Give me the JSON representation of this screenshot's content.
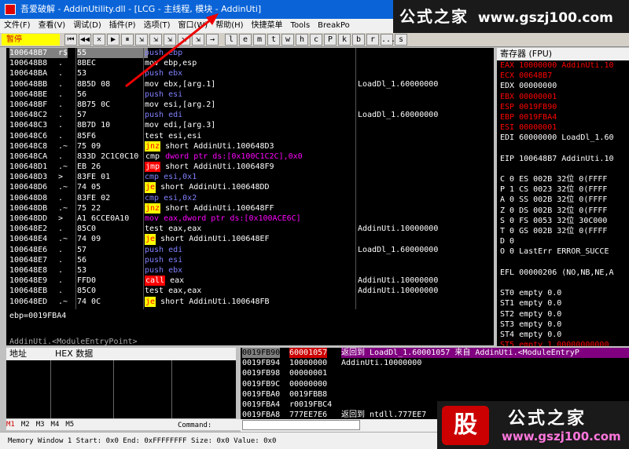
{
  "window": {
    "title": "吾爱破解 - AddinUtility.dll - [LCG - 主线程, 模块 - AddinUti]"
  },
  "menubar": [
    "文件(F)",
    "查看(V)",
    "调试(D)",
    "插件(P)",
    "选项(T)",
    "窗口(W)",
    "帮助(H)",
    "快捷菜单",
    "Tools",
    "BreakPo"
  ],
  "toolbar": {
    "status": "暂停",
    "buttons": [
      "⏮",
      "◀◀",
      "✕",
      "▶",
      "⏸",
      "⇲",
      "⇲",
      "⇲",
      "⇲",
      "⇲",
      "→"
    ],
    "letters": [
      "l",
      "e",
      "m",
      "t",
      "w",
      "h",
      "c",
      "P",
      "k",
      "b",
      "r",
      "...",
      "s"
    ]
  },
  "disasm": [
    {
      "addr": "100648B7",
      "mark": "r$",
      "hex": "55",
      "asm": "push ebp",
      "cmt": "",
      "color": "#8080ff",
      "sel": true
    },
    {
      "addr": "100648B8",
      "mark": ".",
      "hex": "8BEC",
      "asm": "mov ebp,esp",
      "cmt": "",
      "color": "#fff"
    },
    {
      "addr": "100648BA",
      "mark": ".",
      "hex": "53",
      "asm": "push ebx",
      "cmt": "",
      "color": "#8080ff"
    },
    {
      "addr": "100648BB",
      "mark": ".",
      "hex": "8B5D 08",
      "asm": "mov ebx,[arg.1]",
      "cmt": "LoadDl_1.60000000",
      "color": "#fff"
    },
    {
      "addr": "100648BE",
      "mark": ".",
      "hex": "56",
      "asm": "push esi",
      "cmt": "",
      "color": "#8080ff"
    },
    {
      "addr": "100648BF",
      "mark": ".",
      "hex": "8B75 0C",
      "asm": "mov esi,[arg.2]",
      "cmt": "",
      "color": "#fff"
    },
    {
      "addr": "100648C2",
      "mark": ".",
      "hex": "57",
      "asm": "push edi",
      "cmt": "LoadDl_1.60000000",
      "color": "#8080ff"
    },
    {
      "addr": "100648C3",
      "mark": ".",
      "hex": "8B7D 10",
      "asm": "mov edi,[arg.3]",
      "cmt": "",
      "color": "#fff"
    },
    {
      "addr": "100648C6",
      "mark": ".",
      "hex": "85F6",
      "asm": "test esi,esi",
      "cmt": "",
      "color": "#fff"
    },
    {
      "addr": "100648C8",
      "mark": ".~",
      "hex": "75 09",
      "asm": "short AddinUti.100648D3",
      "kw": "jnz",
      "kwbg": "#ff0",
      "cmt": "",
      "color": "#fff"
    },
    {
      "addr": "100648CA",
      "mark": ".",
      "hex": "833D 2C1C0C10",
      "asm": "dword ptr ds:[0x100C1C2C],0x0",
      "kw": "cmp",
      "cmt": "",
      "color": "#f0f"
    },
    {
      "addr": "100648D1",
      "mark": ".~",
      "hex": "EB 26",
      "asm": "short AddinUti.100648F9",
      "kw": "jmp",
      "kwbg": "#f00",
      "cmt": "",
      "color": "#fff"
    },
    {
      "addr": "100648D3",
      "mark": ">",
      "hex": "83FE 01",
      "asm": "cmp esi,0x1",
      "cmt": "",
      "color": "#8080ff"
    },
    {
      "addr": "100648D6",
      "mark": ".~",
      "hex": "74 05",
      "asm": "short AddinUti.100648DD",
      "kw": "je",
      "kwbg": "#ff0",
      "cmt": "",
      "color": "#fff"
    },
    {
      "addr": "100648D8",
      "mark": ".",
      "hex": "83FE 02",
      "asm": "cmp esi,0x2",
      "cmt": "",
      "color": "#8080ff"
    },
    {
      "addr": "100648DB",
      "mark": ".~",
      "hex": "75 22",
      "asm": "short AddinUti.100648FF",
      "kw": "jnz",
      "kwbg": "#ff0",
      "cmt": "",
      "color": "#fff"
    },
    {
      "addr": "100648DD",
      "mark": ">",
      "hex": "A1 6CCE0A10",
      "asm": "mov eax,dword ptr ds:[0x100ACE6C]",
      "cmt": "",
      "color": "#f0f"
    },
    {
      "addr": "100648E2",
      "mark": ".",
      "hex": "85C0",
      "asm": "test eax,eax",
      "cmt": "AddinUti.10000000",
      "color": "#fff"
    },
    {
      "addr": "100648E4",
      "mark": ".~",
      "hex": "74 09",
      "asm": "short AddinUti.100648EF",
      "kw": "je",
      "kwbg": "#ff0",
      "cmt": "",
      "color": "#fff"
    },
    {
      "addr": "100648E6",
      "mark": ".",
      "hex": "57",
      "asm": "push edi",
      "cmt": "LoadDl_1.60000000",
      "color": "#8080ff"
    },
    {
      "addr": "100648E7",
      "mark": ".",
      "hex": "56",
      "asm": "push esi",
      "cmt": "",
      "color": "#8080ff"
    },
    {
      "addr": "100648E8",
      "mark": ".",
      "hex": "53",
      "asm": "push ebx",
      "cmt": "",
      "color": "#8080ff"
    },
    {
      "addr": "100648E9",
      "mark": ".",
      "hex": "FFD0",
      "asm": "eax",
      "kw": "call",
      "kwbg": "#f00",
      "cmt": "AddinUti.10000000",
      "color": "#fff"
    },
    {
      "addr": "100648EB",
      "mark": ".",
      "hex": "85C0",
      "asm": "test eax,eax",
      "cmt": "AddinUti.10000000",
      "color": "#fff"
    },
    {
      "addr": "100648ED",
      "mark": ".~",
      "hex": "74 0C",
      "asm": "short AddinUti.100648FB",
      "kw": "je",
      "kwbg": "#ff0",
      "cmt": "",
      "color": "#fff"
    }
  ],
  "info": {
    "line1": "ebp=0019FBA4",
    "line2": "AddinUti.<ModuleEntryPoint>"
  },
  "registers": {
    "header": "寄存器 (FPU)",
    "lines": [
      {
        "t": "EAX 10000000 AddinUti.10",
        "c": "#f00"
      },
      {
        "t": "ECX 00648B7",
        "c": "#f00"
      },
      {
        "t": "EDX 00000000",
        "c": "#fff"
      },
      {
        "t": "EBX 00000001",
        "c": "#f00"
      },
      {
        "t": "ESP 0019FB90",
        "c": "#f00"
      },
      {
        "t": "EBP 0019FBA4",
        "c": "#f00"
      },
      {
        "t": "ESI 00000001",
        "c": "#f00"
      },
      {
        "t": "EDI 60000000 LoadDl_1.60",
        "c": "#fff"
      },
      {
        "t": "",
        "c": "#fff"
      },
      {
        "t": "EIP 100648B7 AddinUti.10",
        "c": "#fff"
      },
      {
        "t": "",
        "c": "#fff"
      },
      {
        "t": "C 0  ES 002B 32位 0(FFFF",
        "c": "#fff"
      },
      {
        "t": "P 1  CS 0023 32位 0(FFFF",
        "c": "#fff"
      },
      {
        "t": "A 0  SS 002B 32位 0(FFFF",
        "c": "#fff"
      },
      {
        "t": "Z 0  DS 002B 32位 0(FFFF",
        "c": "#fff"
      },
      {
        "t": "S 0  FS 0053 32位 30C000",
        "c": "#fff"
      },
      {
        "t": "T 0  GS 002B 32位 0(FFFF",
        "c": "#fff"
      },
      {
        "t": "D 0",
        "c": "#fff"
      },
      {
        "t": "O 0  LastErr ERROR_SUCCE",
        "c": "#fff"
      },
      {
        "t": "",
        "c": "#fff"
      },
      {
        "t": "EFL 00000206 (NO,NB,NE,A",
        "c": "#fff"
      },
      {
        "t": "",
        "c": "#fff"
      },
      {
        "t": "ST0 empty 0.0",
        "c": "#fff"
      },
      {
        "t": "ST1 empty 0.0",
        "c": "#fff"
      },
      {
        "t": "ST2 empty 0.0",
        "c": "#fff"
      },
      {
        "t": "ST3 empty 0.0",
        "c": "#fff"
      },
      {
        "t": "ST4 empty 0.0",
        "c": "#fff"
      },
      {
        "t": "ST5 empty 1.00000000000",
        "c": "#f00"
      },
      {
        "t": "ST6 empty 1.00000000000",
        "c": "#f00"
      }
    ]
  },
  "dump": {
    "col_addr": "地址",
    "col_hex": "HEX 数据"
  },
  "stack": [
    {
      "addr": "0019FB90",
      "val": "60001057",
      "cmt": "返回到 LoadDl_1.60001057 来自 AddinUti.<ModuleEntryP",
      "sel": true
    },
    {
      "addr": "0019FB94",
      "val": "10000000",
      "cmt": "AddinUti.10000000"
    },
    {
      "addr": "0019FB98",
      "val": "00000001",
      "cmt": ""
    },
    {
      "addr": "0019FB9C",
      "val": "00000000",
      "cmt": ""
    },
    {
      "addr": "0019FBA0",
      "val": "0019FBB8",
      "cmt": ""
    },
    {
      "addr": "0019FBA4",
      "val": "r0019FBC4",
      "cmt": ""
    },
    {
      "addr": "0019FBA8",
      "val": "777EE7E6",
      "cmt": "返回到 ntdll.777EE7"
    }
  ],
  "tabs": [
    "M1",
    "M2",
    "M3",
    "M4",
    "M5"
  ],
  "command": {
    "label": "Command:",
    "value": ""
  },
  "status": "Memory Window 1   Start: 0x0   End: 0xFFFFFFFF   Size: 0x0 Value: 0x0",
  "watermark": {
    "top_cn": "公式之家",
    "top_url": "www.gszj100.com",
    "logo": "股",
    "bottom_cn": "公式之家",
    "bottom_url": "www.gszj100.com"
  }
}
